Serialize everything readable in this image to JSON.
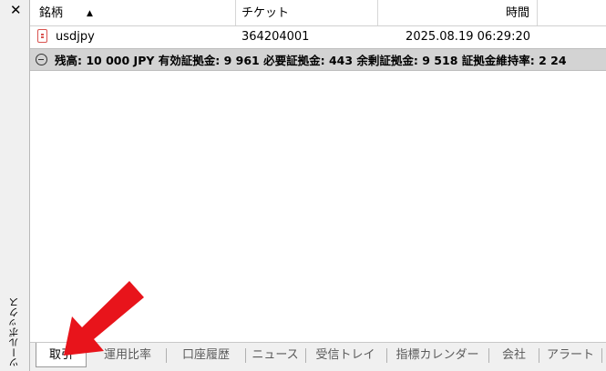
{
  "panel": {
    "title": "ツールボックス",
    "close_label": "✕"
  },
  "table": {
    "headers": {
      "symbol": "銘柄",
      "ticket": "チケット",
      "time": "時間"
    },
    "rows": [
      {
        "symbol": "usdjpy",
        "ticket": "364204001",
        "time": "2025.08.19 06:29:20"
      }
    ]
  },
  "summary": {
    "text": "残高: 10 000 JPY  有効証拠金: 9 961  必要証拠金: 443  余剰証拠金: 9 518  証拠金維持率: 2 24"
  },
  "tabs": [
    "取引",
    "運用比率",
    "口座履歴",
    "ニュース",
    "受信トレイ",
    "指標カレンダー",
    "会社",
    "アラート"
  ],
  "colors": {
    "arrow": "#e8141b",
    "summary_bg": "#d3d3d3",
    "doc_icon": "#d9534f"
  }
}
